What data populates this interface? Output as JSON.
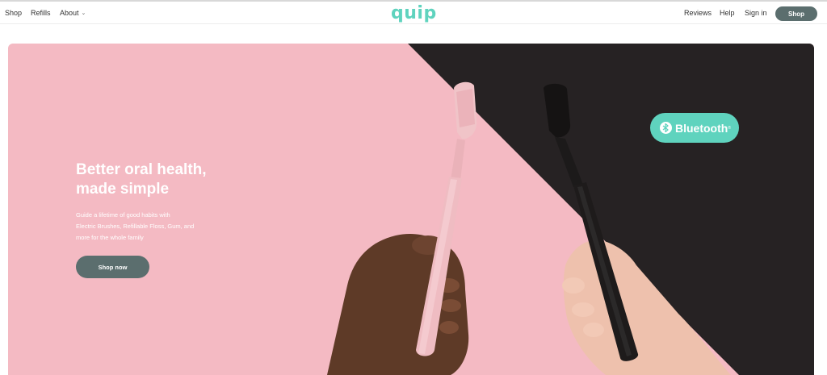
{
  "nav": {
    "left": [
      "Shop",
      "Refills",
      "About"
    ],
    "brand": "quip",
    "right": [
      "Reviews",
      "Help",
      "Sign in"
    ],
    "shop_button": "Shop"
  },
  "hero": {
    "headline_line1": "Better oral health,",
    "headline_line2": "made simple",
    "subtext_line1": "Guide a lifetime of good habits with",
    "subtext_line2": "Electric Brushes, Refillable Floss, Gum, and",
    "subtext_line3": "more for the whole family",
    "cta": "Shop now",
    "badge": "Bluetooth",
    "badge_tm": "®"
  },
  "colors": {
    "brand_teal": "#5fd3be",
    "button_slate": "#5b6e6e",
    "hero_pink": "#f4bac3",
    "hero_dark": "#262223"
  }
}
